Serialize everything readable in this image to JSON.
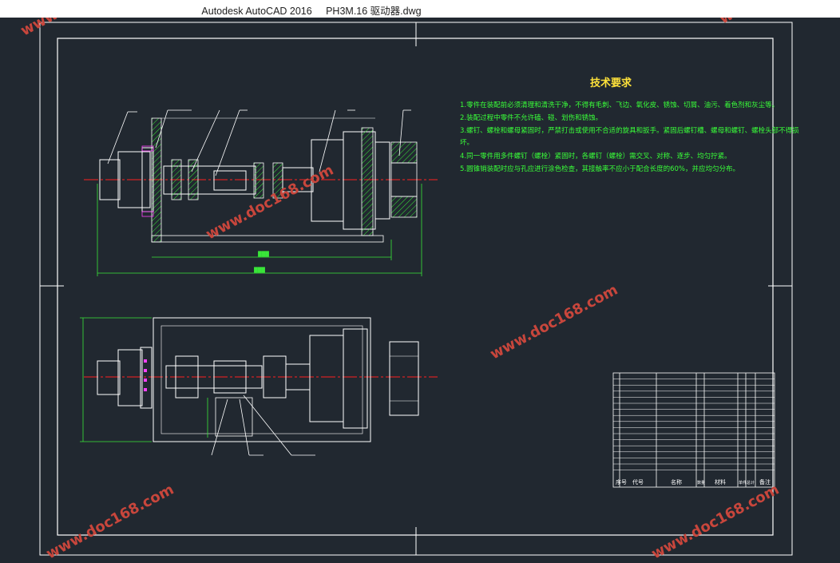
{
  "window": {
    "app_title": "Autodesk AutoCAD 2016",
    "file_name": "PH3M.16 驱动器.dwg"
  },
  "drawing": {
    "tech_title": "技术要求",
    "notes": [
      "1.零件在装配前必须清理和清洗干净，不得有毛刺、飞边、氧化皮、锈蚀、切屑、油污、着色剂和灰尘等。",
      "2.装配过程中零件不允许磕、碰、划伤和锈蚀。",
      "3.螺钉、螺栓和螺母紧固时，严禁打击或使用不合适的旋具和扳手。紧固后螺钉槽、螺母和螺钉、螺栓头部不得损",
      "坏。",
      "4.同一零件用多件螺钉（螺栓）紧固时，各螺钉（螺栓）需交叉、对称、逐步、均匀拧紧。",
      "5.圆锥销装配时应与孔应进行涂色检查，其接触率不应小于配合长度的60%，并应均匀分布。"
    ],
    "dim_label": "███",
    "table_headers": [
      "序号",
      "代号",
      "名称",
      "数量",
      "材料",
      "单件",
      "总计",
      "备注"
    ]
  },
  "watermark": "www.doc168.com",
  "colors": {
    "background": "#212830",
    "frame": "#ffffff",
    "centerline": "#ff2020",
    "dimension": "#39e639",
    "hatch": "#39e639",
    "text_notes": "#39ff39",
    "title_tech": "#ffe23a",
    "magenta": "#ff40ff",
    "watermark": "#c8463c"
  }
}
